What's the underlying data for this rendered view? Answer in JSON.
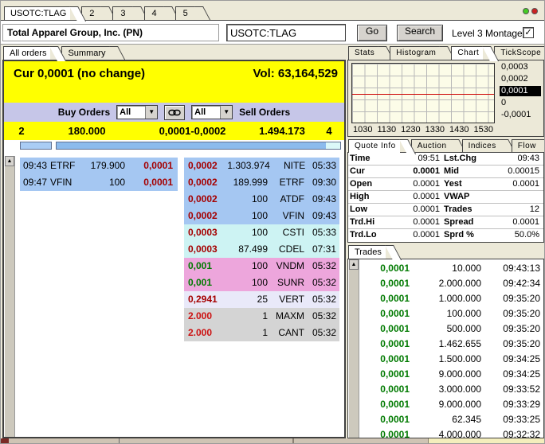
{
  "window": {
    "main_tabs": [
      {
        "label": "USOTC:TLAG",
        "active": true
      },
      {
        "label": "2",
        "active": false
      },
      {
        "label": "3",
        "active": false
      },
      {
        "label": "4",
        "active": false
      },
      {
        "label": "5",
        "active": false
      }
    ],
    "status_dots": {
      "green": "#44cc22",
      "red": "#cc2222"
    }
  },
  "header": {
    "company_name": "Total Apparel Group, Inc. (PN)",
    "symbol_value": "USOTC:TLAG",
    "go_label": "Go",
    "search_label": "Search",
    "montage_label": "Level 3 Montage",
    "montage_checkmark": "✓"
  },
  "left_panel": {
    "tabs": {
      "all_orders": "All orders",
      "summary": "Summary"
    },
    "summary": {
      "cur_line": "Cur 0,0001 (no change)",
      "vol_line": "Vol: 63,164,529"
    },
    "toolbar": {
      "buy_label": "Buy Orders",
      "buy_filter_value": "All",
      "sell_filter_value": "All",
      "sell_label": "Sell Orders",
      "arrow_glyph": "▼"
    },
    "best_row": {
      "bid_count": "2",
      "bid_size": "180.000",
      "bid_ask_price": "0,0001-0,0002",
      "ask_size": "1.494.173",
      "ask_count": "4"
    },
    "scroll_up_glyph": "▲",
    "book": {
      "buy": [
        {
          "time": "09:43",
          "mm": "ETRF",
          "size": "179.900",
          "price": "0,0001"
        },
        {
          "time": "09:47",
          "mm": "VFIN",
          "size": "100",
          "price": "0,0001"
        }
      ],
      "sell": [
        {
          "price": "0,0002",
          "size": "1.303.974",
          "mm": "NITE",
          "time": "05:33"
        },
        {
          "price": "0,0002",
          "size": "189.999",
          "mm": "ETRF",
          "time": "09:30"
        },
        {
          "price": "0,0002",
          "size": "100",
          "mm": "ATDF",
          "time": "09:43"
        },
        {
          "price": "0,0002",
          "size": "100",
          "mm": "VFIN",
          "time": "09:43"
        },
        {
          "price": "0,0003",
          "size": "100",
          "mm": "CSTI",
          "time": "05:33"
        },
        {
          "price": "0,0003",
          "size": "87.499",
          "mm": "CDEL",
          "time": "07:31"
        },
        {
          "price": "0,001",
          "size": "100",
          "mm": "VNDM",
          "time": "05:32"
        },
        {
          "price": "0,001",
          "size": "100",
          "mm": "SUNR",
          "time": "05:32"
        },
        {
          "price": "0,2941",
          "size": "25",
          "mm": "VERT",
          "time": "05:32"
        },
        {
          "price": "2.000",
          "size": "1",
          "mm": "MAXM",
          "time": "05:32"
        },
        {
          "price": "2.000",
          "size": "1",
          "mm": "CANT",
          "time": "05:32"
        }
      ]
    }
  },
  "right_panel": {
    "chart_tabs": [
      {
        "label": "Stats",
        "active": false
      },
      {
        "label": "Histogram",
        "active": false
      },
      {
        "label": "Chart",
        "active": true
      },
      {
        "label": "TickScope",
        "active": false
      }
    ],
    "info_tabs": [
      {
        "label": "Quote Info",
        "active": true
      },
      {
        "label": "Auction",
        "active": false
      },
      {
        "label": "Indices",
        "active": false
      },
      {
        "label": "Flow",
        "active": false
      }
    ],
    "quote_info": [
      {
        "l1": "Time",
        "v1": "09:51",
        "l2": "Lst.Chg",
        "v2": "09:43"
      },
      {
        "l1": "Cur",
        "v1": "0.0001",
        "l2": "Mid",
        "v2": "0.00015"
      },
      {
        "l1": "Open",
        "v1": "0.0001",
        "l2": "Yest",
        "v2": "0.0001"
      },
      {
        "l1": "High",
        "v1": "0.0001",
        "l2": "VWAP",
        "v2": ""
      },
      {
        "l1": "Low",
        "v1": "0.0001",
        "l2": "Trades",
        "v2": "12"
      },
      {
        "l1": "Trd.Hi",
        "v1": "0.0001",
        "l2": "Spread",
        "v2": "0.0001"
      },
      {
        "l1": "Trd.Lo",
        "v1": "0.0001",
        "l2": "Sprd %",
        "v2": "50.0%"
      }
    ],
    "trades_tab_label": "Trades",
    "trades": [
      {
        "price": "0,0001",
        "size": "10.000",
        "time": "09:43:13"
      },
      {
        "price": "0,0001",
        "size": "2.000.000",
        "time": "09:42:34"
      },
      {
        "price": "0,0001",
        "size": "1.000.000",
        "time": "09:35:20"
      },
      {
        "price": "0,0001",
        "size": "100.000",
        "time": "09:35:20"
      },
      {
        "price": "0,0001",
        "size": "500.000",
        "time": "09:35:20"
      },
      {
        "price": "0,0001",
        "size": "1.462.655",
        "time": "09:35:20"
      },
      {
        "price": "0,0001",
        "size": "1.500.000",
        "time": "09:34:25"
      },
      {
        "price": "0,0001",
        "size": "9.000.000",
        "time": "09:34:25"
      },
      {
        "price": "0,0001",
        "size": "3.000.000",
        "time": "09:33:52"
      },
      {
        "price": "0,0001",
        "size": "9.000.000",
        "time": "09:33:29"
      },
      {
        "price": "0,0001",
        "size": "62.345",
        "time": "09:33:25"
      },
      {
        "price": "0,0001",
        "size": "4.000.000",
        "time": "09:32:32"
      }
    ]
  },
  "chart_data": {
    "type": "line",
    "title": "",
    "x": [
      "1030",
      "1130",
      "1230",
      "1330",
      "1430",
      "1530"
    ],
    "series": [
      {
        "name": "price",
        "values": [
          0.0001,
          0.0001,
          0.0001,
          0.0001,
          0.0001,
          0.0001
        ]
      }
    ],
    "ylim": [
      -0.0001,
      0.0003
    ],
    "ytick_labels": [
      "0,0003",
      "0,0002",
      "0,0001",
      "0",
      "-0,0001"
    ],
    "highlighted_ytick": "0,0001",
    "xtick_labels": [
      "1030",
      "1130",
      "1230",
      "1330",
      "1430",
      "1530"
    ],
    "grid": true,
    "line_color": "#cc0000",
    "plot_bg": "#fcfce8"
  }
}
